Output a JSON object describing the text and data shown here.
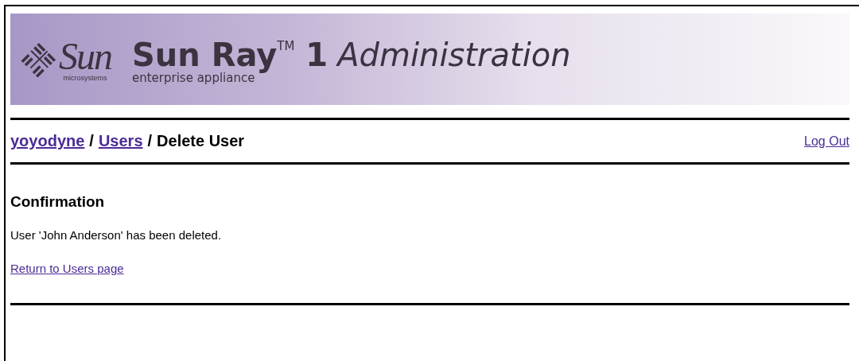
{
  "banner": {
    "logo_word": "Sun",
    "logo_subtitle": "microsystems",
    "product": "Sun Ray$^{TM}$ 1",
    "title": "Administration",
    "tagline": "enterprise appliance"
  },
  "breadcrumb": [
    {
      "label": "yoyodyne",
      "kind": "link"
    },
    {
      "label": "/",
      "kind": "separator"
    },
    {
      "label": "Users",
      "kind": "link"
    },
    {
      "label": "/",
      "kind": "separator"
    },
    {
      "label": "Delete User",
      "kind": "current"
    }
  ],
  "logout": "Log Out",
  "heading": "Confirmation",
  "message": "User 'John Anderson' has been deleted.",
  "return_link": "Return to Users page"
}
